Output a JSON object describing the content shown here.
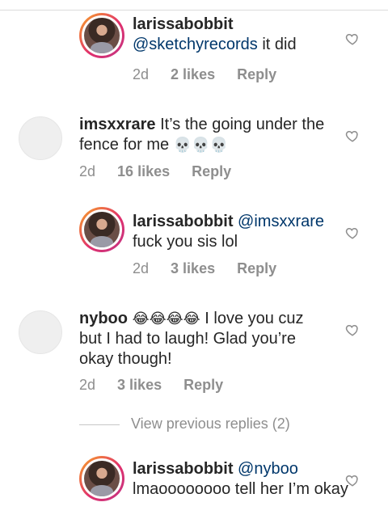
{
  "comments": [
    {
      "username": "larissabobbit",
      "mention": "@sketchyrecords",
      "body": " it did",
      "age": "2d",
      "likes": "2 likes",
      "reply": "Reply"
    },
    {
      "username": "imsxxrare",
      "body": " It’s the going under the fence for me",
      "emoji": "💀💀💀",
      "age": "2d",
      "likes": "16 likes",
      "reply": "Reply"
    },
    {
      "username": "larissabobbit",
      "mention": "@imsxxrare",
      "body": "fuck you sis lol",
      "age": "2d",
      "likes": "3 likes",
      "reply": "Reply"
    },
    {
      "username": "nyboo",
      "emoji": "😂😂😂😂",
      "body": " I love you cuz but I had to laugh! Glad you’re okay though!",
      "age": "2d",
      "likes": "3 likes",
      "reply": "Reply"
    },
    {
      "username": "larissabobbit",
      "mention": "@nyboo",
      "body": "lmaoooooooo tell her I’m okay"
    }
  ],
  "view_previous": "View previous replies (2)",
  "icons": {
    "like": "heart-outline-icon"
  }
}
